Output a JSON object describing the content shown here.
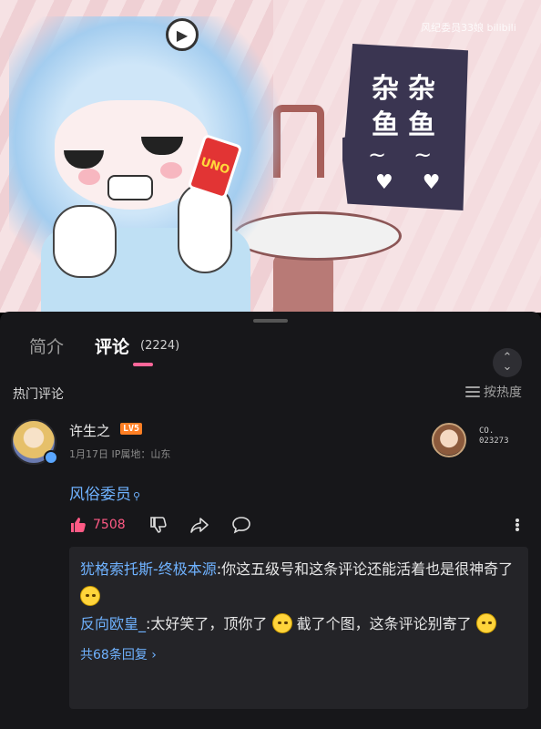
{
  "video": {
    "bubble_line1": "杂杂",
    "bubble_line2": "鱼鱼",
    "bubble_tilde": "~~",
    "bubble_hearts": "♥♥",
    "uno_text": "UNO",
    "watermark": "风纪委员33娘 bilibili"
  },
  "tabs": {
    "intro": "简介",
    "comments": "评论",
    "comment_count": "(2224)"
  },
  "section": {
    "title": "热门评论",
    "sort_label": "按热度"
  },
  "comment": {
    "username": "许生之",
    "level": "LV5",
    "meta": "1月17日 IP属地：山东",
    "fan_no_line1": "CO.",
    "fan_no_line2": "023273",
    "text": "风俗委员",
    "likes": "7508"
  },
  "replies": [
    {
      "user": "犹格索托斯-终极本源",
      "text": ":你这五级号和这条评论还能活着也是很神奇了"
    },
    {
      "user": "反向欧皇_",
      "text": ":太好笑了，顶你了",
      "text2": "截了个图，这条评论别寄了"
    }
  ],
  "reply_more": "共68条回复 ›",
  "colors": {
    "accent_pink": "#ff6699",
    "link_blue": "#6fb2ff",
    "level_orange": "#ff7f24"
  }
}
